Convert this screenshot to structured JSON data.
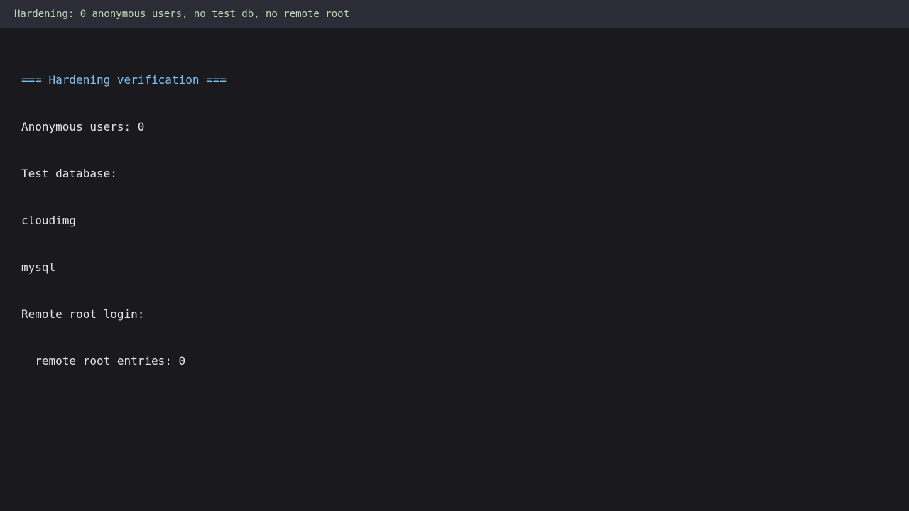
{
  "status_bar": {
    "text": "Hardening: 0 anonymous users, no test db, no remote root"
  },
  "terminal": {
    "lines": [
      "=== Hardening verification ===",
      "Anonymous users: 0",
      "Test database:",
      "cloudimg",
      "mysql",
      "Remote root login:",
      "  remote root entries: 0"
    ]
  },
  "colors": {
    "background": "#1a191e",
    "status_bar_background": "#2c2c37",
    "status_text": "#bcd8b4",
    "heading_text": "#7ec3f5",
    "output_text": "#e4e4e6"
  }
}
